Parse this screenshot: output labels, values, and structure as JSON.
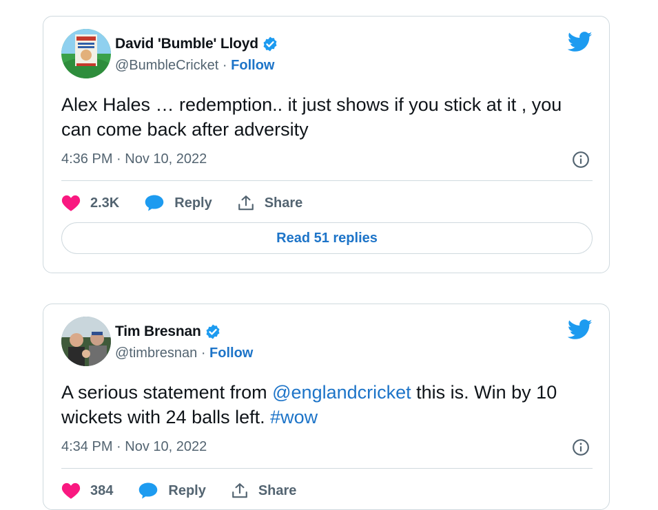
{
  "tweets": [
    {
      "author": "David 'Bumble' Lloyd",
      "handle": "@BumbleCricket",
      "separator": "·",
      "follow": "Follow",
      "text": "Alex Hales … redemption.. it just shows if you stick at it , you can come back after adversity",
      "timestamp": "4:36 PM · Nov 10, 2022",
      "likes": "2.3K",
      "reply_label": "Reply",
      "share_label": "Share",
      "read_replies": "Read 51 replies"
    },
    {
      "author": "Tim Bresnan",
      "handle": "@timbresnan",
      "separator": "·",
      "follow": "Follow",
      "text_parts": {
        "a": "A serious statement from ",
        "mention": "@englandcricket",
        "b": " this is. Win by 10 wickets with 24 balls left. ",
        "hashtag": "#wow"
      },
      "timestamp": "4:34 PM · Nov 10, 2022",
      "likes": "384",
      "reply_label": "Reply",
      "share_label": "Share"
    }
  ],
  "icons": {
    "verified": "verified-badge-icon",
    "twitter": "twitter-bird-icon",
    "info": "info-icon",
    "like": "heart-icon",
    "reply": "speech-bubble-icon",
    "share": "share-icon"
  },
  "colors": {
    "link": "#1d74c8",
    "twitter_blue": "#1d9bf0",
    "like": "#f91880",
    "muted": "#536471",
    "border": "#cfd9de"
  }
}
